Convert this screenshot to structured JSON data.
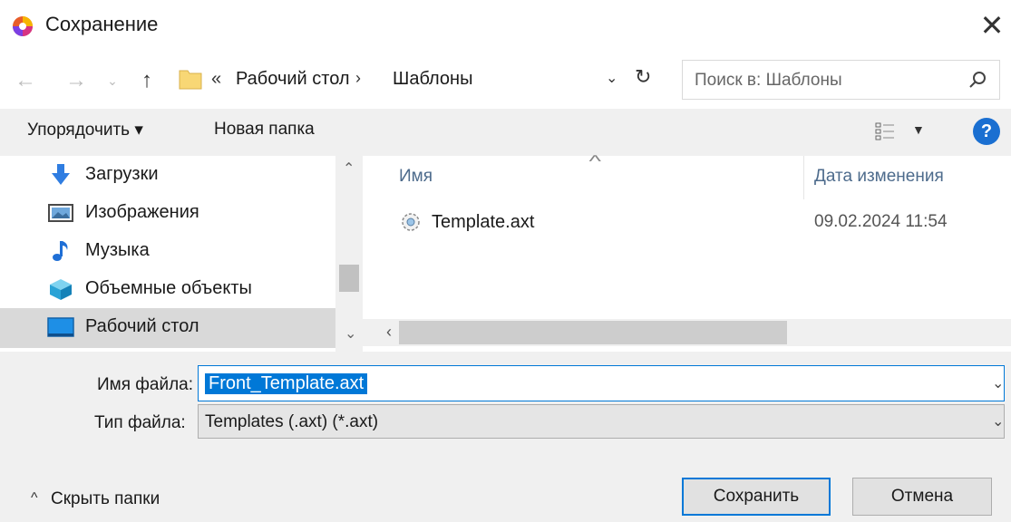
{
  "window": {
    "title": "Сохранение"
  },
  "address": {
    "prefix": "«",
    "crumbs": [
      "Рабочий стол",
      "Шаблоны"
    ],
    "separator": "›"
  },
  "search": {
    "placeholder": "Поиск в: Шаблоны"
  },
  "toolbar": {
    "organize_label": "Упорядочить ▾",
    "new_folder_label": "Новая папка",
    "help_label": "?"
  },
  "nav_pane": {
    "items": [
      {
        "label": "Загрузки",
        "icon": "download-arrow-icon"
      },
      {
        "label": "Изображения",
        "icon": "pictures-icon"
      },
      {
        "label": "Музыка",
        "icon": "music-note-icon"
      },
      {
        "label": "Объемные объекты",
        "icon": "3d-objects-icon"
      },
      {
        "label": "Рабочий стол",
        "icon": "desktop-icon",
        "selected": true
      }
    ]
  },
  "file_list": {
    "columns": [
      "Имя",
      "Дата изменения"
    ],
    "rows": [
      {
        "name": "Template.axt",
        "date": "09.02.2024 11:54"
      }
    ]
  },
  "form": {
    "filename_label": "Имя файла:",
    "filename_value": "Front_Template.axt",
    "filetype_label": "Тип файла:",
    "filetype_value": "Templates (.axt) (*.axt)"
  },
  "footer": {
    "hide_folders_label": "Скрыть папки",
    "save_label": "Сохранить",
    "cancel_label": "Отмена"
  },
  "colors": {
    "accent": "#0078d7",
    "selection_bg": "#d9d9d9",
    "panel_bg": "#f0f0f0"
  }
}
